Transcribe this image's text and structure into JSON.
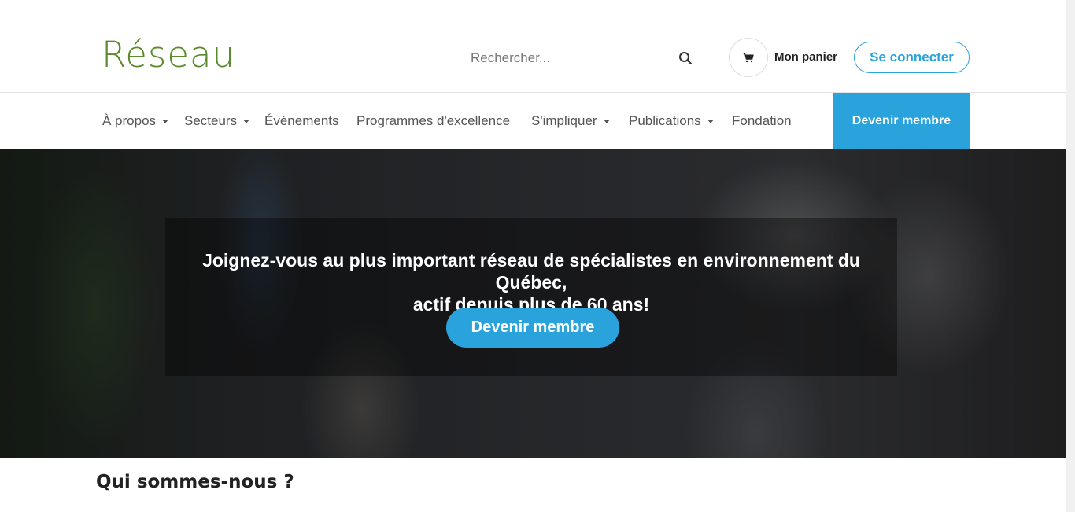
{
  "header": {
    "logo_text": "Réseau",
    "search": {
      "placeholder": "Rechercher..."
    },
    "cart_label": "Mon panier",
    "login_label": "Se connecter"
  },
  "nav": {
    "items": [
      {
        "label": "À propos",
        "dropdown": true
      },
      {
        "label": "Secteurs",
        "dropdown": true
      },
      {
        "label": "Événements",
        "dropdown": false
      },
      {
        "label": "Programmes d'excellence",
        "dropdown": false
      },
      {
        "label": "S'impliquer",
        "dropdown": true
      },
      {
        "label": "Publications",
        "dropdown": true
      },
      {
        "label": "Fondation",
        "dropdown": false
      }
    ],
    "member_button": "Devenir membre"
  },
  "hero": {
    "line1": "Joignez-vous au plus important réseau de spécialistes en environnement du Québec,",
    "line2": "actif depuis plus de 60 ans!",
    "button_label": "Devenir membre"
  },
  "about": {
    "title": "Qui sommes-nous ?"
  },
  "colors": {
    "accent": "#2aa3dc",
    "logo_green": "#5a8a2c"
  }
}
